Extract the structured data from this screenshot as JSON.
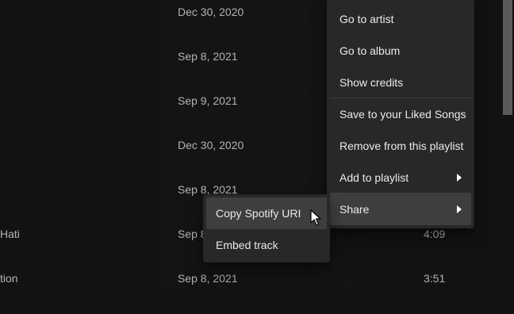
{
  "tracklist": {
    "rows": [
      {
        "title": "",
        "date": "Dec 30, 2020",
        "duration": ""
      },
      {
        "title": "",
        "date": "Sep 8, 2021",
        "duration": ""
      },
      {
        "title": "",
        "date": "Sep 9, 2021",
        "duration": ""
      },
      {
        "title": "",
        "date": "Dec 30, 2020",
        "duration": ""
      },
      {
        "title": "",
        "date": "Sep 8, 2021",
        "duration": ""
      },
      {
        "title": "Hati",
        "date": "Sep 8",
        "duration": "4:09"
      },
      {
        "title": "tion",
        "date": "Sep 8, 2021",
        "duration": "3:51"
      }
    ]
  },
  "context_menu": {
    "items": [
      {
        "label": "Go to artist"
      },
      {
        "label": "Go to album"
      },
      {
        "label": "Show credits"
      },
      {
        "label": "Save to your Liked Songs"
      },
      {
        "label": "Remove from this playlist"
      },
      {
        "label": "Add to playlist",
        "has_submenu": true
      },
      {
        "label": "Share",
        "has_submenu": true,
        "active": true
      }
    ]
  },
  "share_submenu": {
    "items": [
      {
        "label": "Copy Spotify URI",
        "hovered": true
      },
      {
        "label": "Embed track"
      }
    ]
  },
  "colors": {
    "background": "#121212",
    "menu_bg": "#282828",
    "menu_hover": "#3e3e3e",
    "menu_text": "#eaeaea",
    "secondary_text": "#b3b3b3"
  },
  "icons": {
    "submenu_caret": "caret-right-icon",
    "pointer": "mouse-pointer-icon"
  }
}
